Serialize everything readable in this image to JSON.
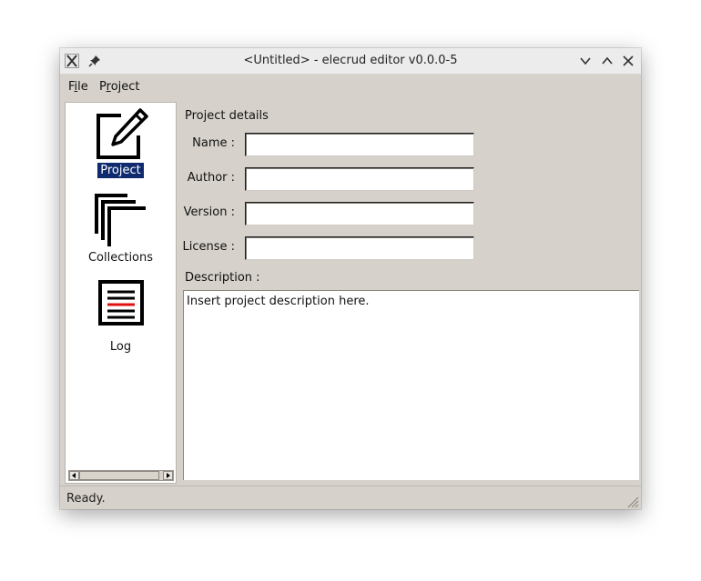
{
  "window": {
    "title": "<Untitled> - elecrud editor v0.0.0-5"
  },
  "menu": {
    "items": [
      {
        "label": "File",
        "mnemonic": "i"
      },
      {
        "label": "Project",
        "mnemonic": "r"
      }
    ]
  },
  "sidebar": {
    "items": [
      {
        "label": "Project",
        "icon": "pencil-edit-icon",
        "selected": true
      },
      {
        "label": "Collections",
        "icon": "stacked-pages-icon",
        "selected": false
      },
      {
        "label": "Log",
        "icon": "log-document-icon",
        "selected": false
      }
    ]
  },
  "form": {
    "section_title": "Project details",
    "name": {
      "label": "Name :",
      "value": ""
    },
    "author": {
      "label": "Author :",
      "value": ""
    },
    "version": {
      "label": "Version :",
      "value": ""
    },
    "license": {
      "label": "License :",
      "value": ""
    },
    "description": {
      "label": "Description :",
      "value": "Insert project description here."
    }
  },
  "status": {
    "text": "Ready."
  },
  "colors": {
    "window_bg": "#d6d2cb",
    "selection_bg": "#0f2a6e",
    "selection_fg": "#ffffff",
    "log_accent": "#e01010"
  }
}
